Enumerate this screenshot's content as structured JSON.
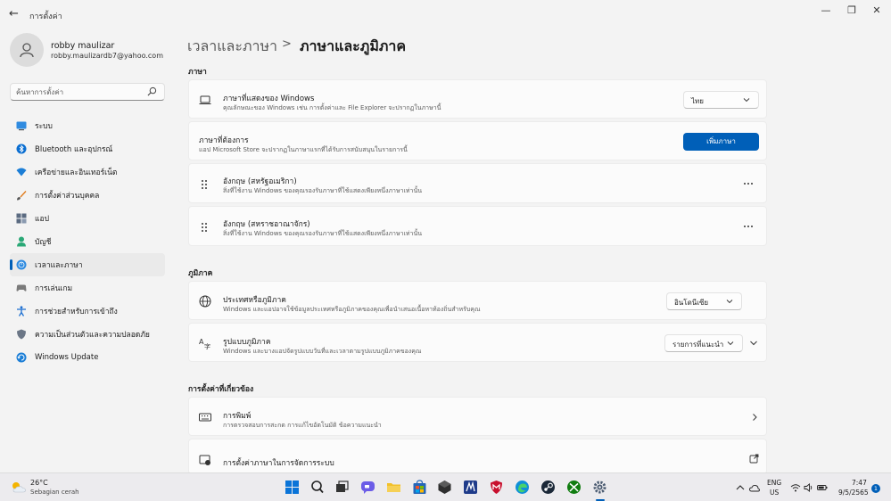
{
  "window": {
    "title": "การตั้งค่า"
  },
  "user": {
    "name": "robby maulizar",
    "email": "robby.maulizardb7@yahoo.com"
  },
  "search": {
    "placeholder": "ค้นหาการตั้งค่า"
  },
  "sidebar": {
    "items": [
      {
        "label": "ระบบ",
        "icon": "system-icon"
      },
      {
        "label": "Bluetooth และอุปกรณ์",
        "icon": "bluetooth-icon"
      },
      {
        "label": "เครือข่ายและอินเทอร์เน็ต",
        "icon": "network-icon"
      },
      {
        "label": "การตั้งค่าส่วนบุคคล",
        "icon": "personalization-icon"
      },
      {
        "label": "แอป",
        "icon": "apps-icon"
      },
      {
        "label": "บัญชี",
        "icon": "accounts-icon"
      },
      {
        "label": "เวลาและภาษา",
        "icon": "time-language-icon",
        "selected": true
      },
      {
        "label": "การเล่นเกม",
        "icon": "gaming-icon"
      },
      {
        "label": "การช่วยสำหรับการเข้าถึง",
        "icon": "accessibility-icon"
      },
      {
        "label": "ความเป็นส่วนตัวและความปลอดภัย",
        "icon": "privacy-shield-icon"
      },
      {
        "label": "Windows Update",
        "icon": "windows-update-icon"
      }
    ]
  },
  "breadcrumb": {
    "parent": "เวลาและภาษา",
    "separator": ">",
    "current": "ภาษาและภูมิภาค"
  },
  "language": {
    "section_title": "ภาษา",
    "display": {
      "title": "ภาษาที่แสดงของ Windows",
      "desc": "คุณลักษณะของ Windows เช่น การตั้งค่าและ File Explorer จะปรากฏในภาษานี้",
      "value": "ไทย"
    },
    "preferred": {
      "title": "ภาษาที่ต้องการ",
      "desc": "แอป Microsoft Store จะปรากฏในภาษาแรกที่ได้รับการสนับสนุนในรายการนี้",
      "button": "เพิ่มภาษา"
    },
    "items": [
      {
        "title": "อังกฤษ (สหรัฐอเมริกา)",
        "desc": "สิ่งที่ใช้งาน Windows ของคุณรองรับภาษาที่ใช้แสดงเพียงหนึ่งภาษาเท่านั้น"
      },
      {
        "title": "อังกฤษ (สหราชอาณาจักร)",
        "desc": "สิ่งที่ใช้งาน Windows ของคุณรองรับภาษาที่ใช้แสดงเพียงหนึ่งภาษาเท่านั้น"
      }
    ]
  },
  "region": {
    "section_title": "ภูมิภาค",
    "country": {
      "title": "ประเทศหรือภูมิภาค",
      "desc": "Windows และแอปอาจใช้ข้อมูลประเทศหรือภูมิภาคของคุณเพื่อนำเสนอเนื้อหาท้องถิ่นสำหรับคุณ",
      "value": "อินโดนีเซีย"
    },
    "format": {
      "title": "รูปแบบภูมิภาค",
      "desc": "Windows และบางแอปจัดรูปแบบวันที่และเวลาตามรูปแบบภูมิภาคของคุณ",
      "value": "รายการที่แนะนำ"
    }
  },
  "related": {
    "section_title": "การตั้งค่าที่เกี่ยวข้อง",
    "typing": {
      "title": "การพิมพ์",
      "desc": "การตรวจสอบการสะกด การแก้ไขอัตโนมัติ ข้อความแนะนำ"
    },
    "admin": {
      "title": "การตั้งค่าภาษาในการจัดการระบบ"
    }
  },
  "taskbar": {
    "weather_temp": "26°C",
    "weather_desc": "Sebagian cerah",
    "lang_line1": "ENG",
    "lang_line2": "US",
    "time": "7:47",
    "date": "9/5/2565",
    "notifications": "1"
  },
  "colors": {
    "accent": "#005fb8",
    "background": "#f3f3f3",
    "card": "#fbfbfb"
  }
}
